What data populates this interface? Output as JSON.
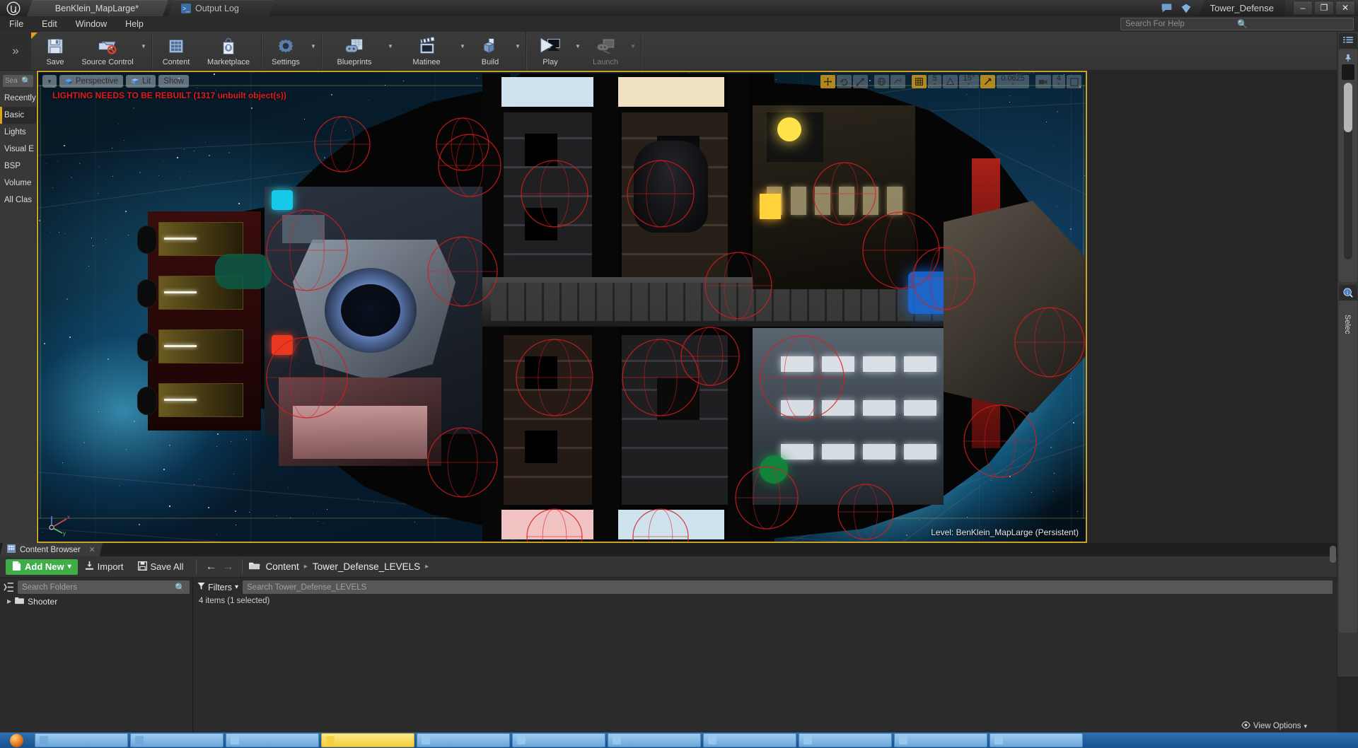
{
  "titlebar": {
    "tabs": [
      {
        "label": "BenKlein_MapLarge*",
        "icon": "unreal-logo"
      },
      {
        "label": "Output Log",
        "icon": "console-icon"
      }
    ],
    "project": "Tower_Defense",
    "window_buttons": {
      "minimize": "–",
      "restore": "❐",
      "close": "✕"
    }
  },
  "menubar": {
    "items": [
      "File",
      "Edit",
      "Window",
      "Help"
    ]
  },
  "help_search": {
    "placeholder": "Search For Help"
  },
  "toolbar": {
    "groups": [
      {
        "buttons": [
          {
            "label": "Save",
            "icon": "save-icon",
            "arrow": false
          },
          {
            "label": "Source Control",
            "icon": "source-control-icon",
            "arrow": true
          }
        ]
      },
      {
        "buttons": [
          {
            "label": "Content",
            "icon": "content-icon",
            "arrow": false
          },
          {
            "label": "Marketplace",
            "icon": "marketplace-icon",
            "arrow": false
          }
        ]
      },
      {
        "buttons": [
          {
            "label": "Settings",
            "icon": "settings-gear-icon",
            "arrow": true
          }
        ]
      },
      {
        "buttons": [
          {
            "label": "Blueprints",
            "icon": "blueprints-icon",
            "arrow": true
          },
          {
            "label": "Matinee",
            "icon": "matinee-clapboard-icon",
            "arrow": true
          },
          {
            "label": "Build",
            "icon": "build-cube-icon",
            "arrow": true
          }
        ]
      },
      {
        "buttons": [
          {
            "label": "Play",
            "icon": "play-icon",
            "arrow": true
          },
          {
            "label": "Launch",
            "icon": "launch-icon",
            "arrow": true,
            "disabled": true
          }
        ]
      }
    ]
  },
  "modes_panel": {
    "search_placeholder": "Sea",
    "items": [
      {
        "label": "Recently",
        "selected": false
      },
      {
        "label": "Basic",
        "selected": true
      },
      {
        "label": "Lights",
        "selected": false
      },
      {
        "label": "Visual E",
        "selected": false
      },
      {
        "label": "BSP",
        "selected": false
      },
      {
        "label": "Volume",
        "selected": false
      },
      {
        "label": "All Clas",
        "selected": false
      }
    ]
  },
  "viewport": {
    "toolbar": {
      "menu_arrow": "▼",
      "perspective": "Perspective",
      "lit": "Lit",
      "show": "Show"
    },
    "warning": "LIGHTING NEEDS TO BE REBUILT (1317 unbuilt object(s))",
    "level_label": "Level:  BenKlein_MapLarge (Persistent)",
    "transform_tools": [
      {
        "name": "select-translate-tool",
        "active": true
      },
      {
        "name": "rotate-tool",
        "active": false
      },
      {
        "name": "scale-tool",
        "active": false
      },
      {
        "name": "coordinate-system-toggle",
        "active": false
      },
      {
        "name": "surface-snap-toggle",
        "active": false
      }
    ],
    "grid_snap": {
      "enabled": true,
      "value": "5"
    },
    "rotation_snap": {
      "enabled": false,
      "value": "15°"
    },
    "scale_snap": {
      "enabled": true,
      "value": "0.0625"
    },
    "camera_speed": {
      "value": "4"
    },
    "axis_labels": {
      "x": "x",
      "y": "y",
      "z": "z"
    }
  },
  "right_panels": {
    "outliner_label": "",
    "details_label": "Selec"
  },
  "content_browser": {
    "tab_label": "Content Browser",
    "tab_close": "✕",
    "toolbar": {
      "add_new": "Add New",
      "add_new_arrow": "▾",
      "import": "Import",
      "save_all": "Save All",
      "back_arrow": "←",
      "forward_arrow": "→"
    },
    "breadcrumb": {
      "items": [
        "Content",
        "Tower_Defense_LEVELS"
      ],
      "separator": "▸",
      "trailing": "▸"
    },
    "folders_search_placeholder": "Search Folders",
    "folders": [
      {
        "label": "Shooter",
        "expandable": true
      }
    ],
    "filters_label": "Filters",
    "filters_arrow": "▾",
    "asset_search_placeholder": "Search Tower_Defense_LEVELS",
    "status": "4 items (1 selected)",
    "view_options": "View Options",
    "view_options_arrow": "▾"
  },
  "taskbar": {
    "items": [
      {
        "label": "",
        "color": "#6ba6da"
      },
      {
        "label": "",
        "color": "#6ba6da"
      },
      {
        "label": "",
        "color": "#9ecbf0"
      },
      {
        "label": "",
        "color": "#f5cf3a"
      },
      {
        "label": "",
        "color": "#9ecbf0"
      },
      {
        "label": "",
        "color": "#9ecbf0"
      },
      {
        "label": "",
        "color": "#9ecbf0"
      },
      {
        "label": "",
        "color": "#9ecbf0"
      },
      {
        "label": "",
        "color": "#9ecbf0"
      },
      {
        "label": "",
        "color": "#9ecbf0"
      },
      {
        "label": "",
        "color": "#9ecbf0"
      }
    ]
  },
  "colors": {
    "accent_yellow": "#e0a315",
    "viewport_border": "#c9a227",
    "add_new_green": "#3fae49",
    "warning_red": "#e01b1b",
    "panel_bg": "#383838",
    "toolbar_bg": "#3b3b3b"
  }
}
